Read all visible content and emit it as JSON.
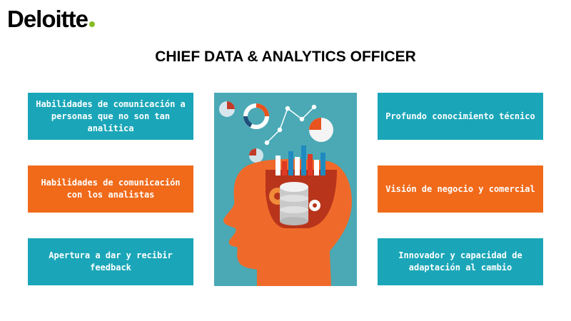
{
  "brand": {
    "logo_text": "Deloitte",
    "dot_color": "#86bc25"
  },
  "header": {
    "title": "CHIEF DATA & ANALYTICS OFFICER"
  },
  "left_boxes": [
    {
      "label": "Habilidades de comunicación a personas que no son tan analítica",
      "color": "#1aa6b8"
    },
    {
      "label": "Habilidades de comunicación con los analistas",
      "color": "#f06a1a"
    },
    {
      "label": "Apertura a dar y recibir feedback",
      "color": "#1aa6b8"
    }
  ],
  "right_boxes": [
    {
      "label": "Profundo conocimiento técnico",
      "color": "#1aa6b8"
    },
    {
      "label": "Visión de negocio y comercial",
      "color": "#f06a1a"
    },
    {
      "label": "Innovador y capacidad de adaptación al cambio",
      "color": "#1aa6b8"
    }
  ],
  "illustration": {
    "icon": "head-data-analytics-icon",
    "colors": {
      "background": "#4aa9b5",
      "head": "#ef6a2a",
      "brain": "#b8341b"
    }
  }
}
